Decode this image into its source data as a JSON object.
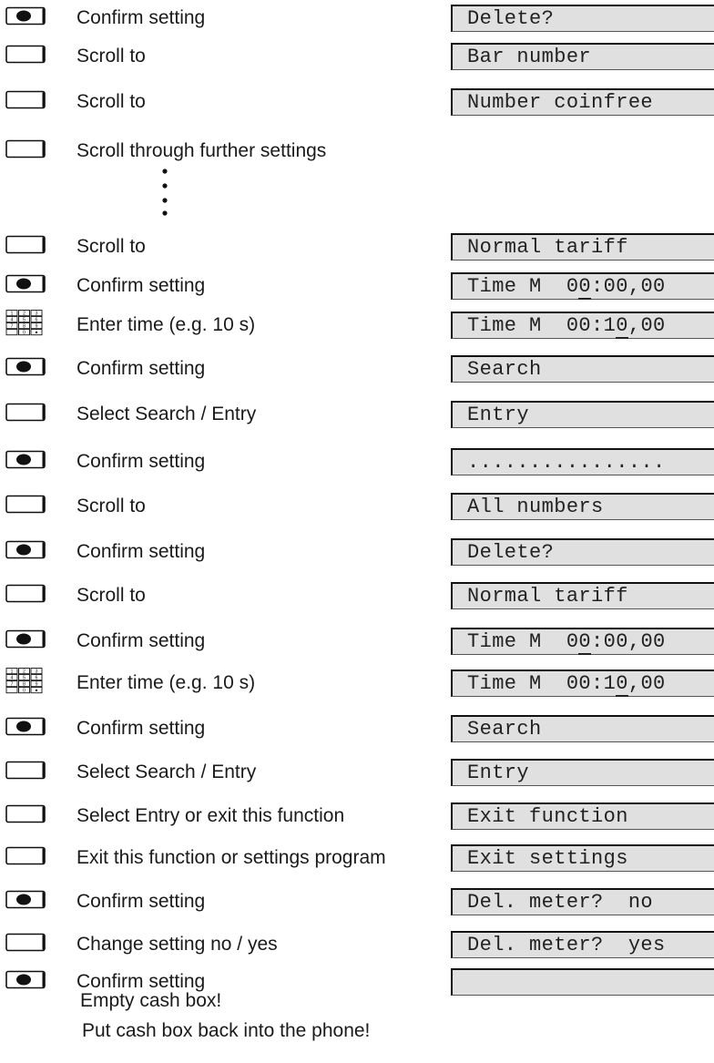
{
  "steps": [
    {
      "icon": "confirm-key-icon",
      "text": "Confirm setting",
      "lcd": "Delete?"
    },
    {
      "icon": "scroll-key-icon",
      "text": "Scroll to",
      "lcd": "Bar number"
    },
    {
      "icon": "scroll-key-icon",
      "text": "Scroll to",
      "lcd": "Number coinfree"
    },
    {
      "icon": "scroll-key-icon",
      "text": "Scroll through further settings",
      "lcd": null
    },
    {
      "icon": "scroll-key-icon",
      "text": "Scroll to",
      "lcd": "Normal tariff"
    },
    {
      "icon": "confirm-key-icon",
      "text": "Confirm setting",
      "lcd": "Time M  00:00,00",
      "underline": 9
    },
    {
      "icon": "keypad-icon",
      "text": "Enter time (e.g. 10 s)",
      "lcd": "Time M  00:10,00",
      "underline": 12
    },
    {
      "icon": "confirm-key-icon",
      "text": "Confirm setting",
      "lcd": "Search"
    },
    {
      "icon": "scroll-key-icon",
      "text": "Select Search / Entry",
      "lcd": "Entry"
    },
    {
      "icon": "confirm-key-icon",
      "text": "Confirm setting",
      "lcd": "................"
    },
    {
      "icon": "scroll-key-icon",
      "text": "Scroll to",
      "lcd": "All numbers"
    },
    {
      "icon": "confirm-key-icon",
      "text": "Confirm setting",
      "lcd": "Delete?"
    },
    {
      "icon": "scroll-key-icon",
      "text": "Scroll to",
      "lcd": "Normal tariff"
    },
    {
      "icon": "confirm-key-icon",
      "text": "Confirm setting",
      "lcd": "Time M  00:00,00",
      "underline": 9
    },
    {
      "icon": "keypad-icon",
      "text": "Enter time (e.g. 10 s)",
      "lcd": "Time M  00:10,00",
      "underline": 12
    },
    {
      "icon": "confirm-key-icon",
      "text": "Confirm setting",
      "lcd": "Search"
    },
    {
      "icon": "scroll-key-icon",
      "text": "Select Search / Entry",
      "lcd": "Entry"
    },
    {
      "icon": "scroll-key-icon",
      "text": "Select Entry or exit this function",
      "lcd": "Exit function"
    },
    {
      "icon": "scroll-key-icon",
      "text": "Exit this function or settings program",
      "lcd": "Exit settings"
    },
    {
      "icon": "confirm-key-icon",
      "text": "Confirm setting",
      "lcd": "Del. meter?  no"
    },
    {
      "icon": "scroll-key-icon",
      "text": "Change setting no / yes",
      "lcd": "Del. meter?  yes"
    },
    {
      "icon": "confirm-key-icon",
      "text": "Confirm setting",
      "lcd": ""
    }
  ],
  "final_notes": [
    "Empty cash box!",
    "Put cash box back into the phone!"
  ],
  "colors": {
    "lcd_background": "#e0e0e0",
    "text": "#1a1a1a"
  }
}
